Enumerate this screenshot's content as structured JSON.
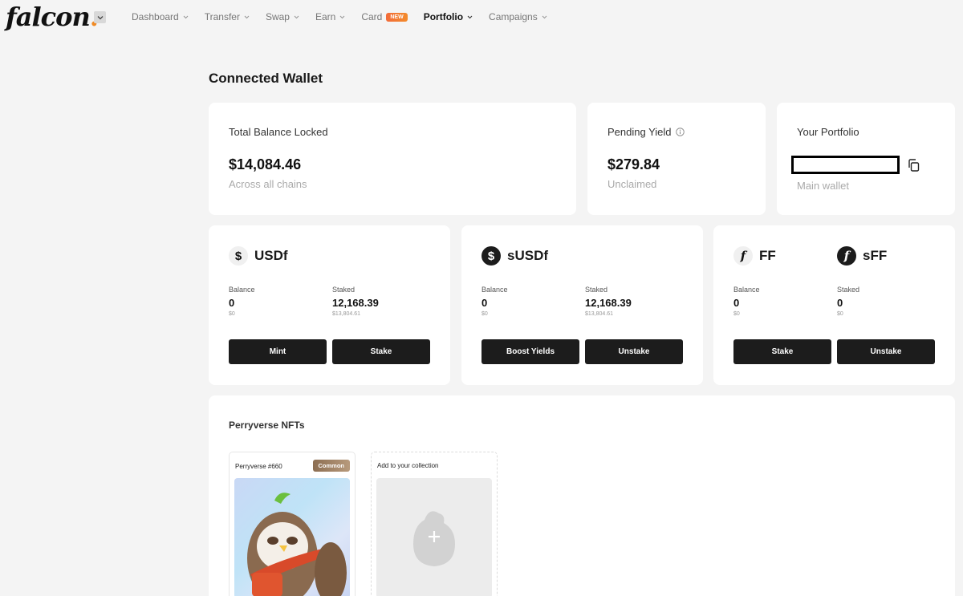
{
  "brand": {
    "name": "falcon",
    "dot": "."
  },
  "nav": {
    "items": [
      {
        "label": "Dashboard",
        "dropdown": true,
        "active": false
      },
      {
        "label": "Transfer",
        "dropdown": true,
        "active": false
      },
      {
        "label": "Swap",
        "dropdown": true,
        "active": false
      },
      {
        "label": "Earn",
        "dropdown": true,
        "active": false
      },
      {
        "label": "Card",
        "dropdown": false,
        "active": false,
        "badge": "NEW"
      },
      {
        "label": "Portfolio",
        "dropdown": true,
        "active": true
      },
      {
        "label": "Campaigns",
        "dropdown": true,
        "active": false
      }
    ]
  },
  "page": {
    "title": "Connected Wallet"
  },
  "summary": {
    "total": {
      "label": "Total Balance Locked",
      "value": "$14,084.46",
      "sub": "Across all chains"
    },
    "yield": {
      "label": "Pending Yield",
      "value": "$279.84",
      "sub": "Unclaimed"
    },
    "portfolio": {
      "label": "Your Portfolio",
      "sub": "Main wallet"
    }
  },
  "assets": {
    "usdf": {
      "name": "USDf",
      "icon": "$",
      "balance_label": "Balance",
      "balance": "0",
      "balance_usd": "$0",
      "staked_label": "Staked",
      "staked": "12,168.39",
      "staked_usd": "$13,804.61",
      "btn1": "Mint",
      "btn2": "Stake"
    },
    "susdf": {
      "name": "sUSDf",
      "icon": "$",
      "balance_label": "Balance",
      "balance": "0",
      "balance_usd": "$0",
      "staked_label": "Staked",
      "staked": "12,168.39",
      "staked_usd": "$13,804.61",
      "btn1": "Boost Yields",
      "btn2": "Unstake"
    },
    "ff": {
      "name": "FF",
      "name2": "sFF",
      "icon": "f",
      "icon2": "f",
      "balance_label": "Balance",
      "balance": "0",
      "balance_usd": "$0",
      "staked_label": "Staked",
      "staked": "0",
      "staked_usd": "$0",
      "btn1": "Stake",
      "btn2": "Unstake"
    }
  },
  "nfts": {
    "title": "Perryverse NFTs",
    "items": [
      {
        "name": "Perryverse #660",
        "rarity": "Common"
      }
    ],
    "add_label": "Add to your collection"
  },
  "colors": {
    "accent": "#f08a24",
    "button": "#1c1c1c",
    "badge": "#f26b3a",
    "rarity": "#a08060"
  }
}
